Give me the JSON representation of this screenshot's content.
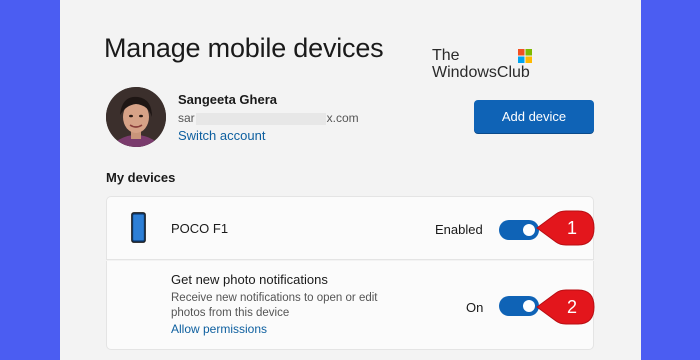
{
  "page": {
    "title": "Manage mobile devices"
  },
  "watermark": {
    "line1": "The",
    "line2": "WindowsClub"
  },
  "account": {
    "name": "Sangeeta Ghera",
    "email_prefix": "sar",
    "email_suffix": "x.com",
    "switch_label": "Switch account"
  },
  "actions": {
    "add_device_label": "Add device"
  },
  "devices_section": {
    "title": "My devices",
    "device": {
      "name": "POCO F1",
      "status_label": "Enabled",
      "enabled": true,
      "icon": "phone-icon"
    },
    "notifications": {
      "title": "Get new photo notifications",
      "description": "Receive new notifications to open or edit photos from this device",
      "link_label": "Allow permissions",
      "status_label": "On",
      "enabled": true
    }
  },
  "callouts": [
    {
      "number": "1"
    },
    {
      "number": "2"
    }
  ],
  "colors": {
    "background": "#4b5df2",
    "panel": "#f3f3f3",
    "accent": "#0f63b6",
    "link": "#0d5f9f",
    "callout": "#e3161c"
  }
}
